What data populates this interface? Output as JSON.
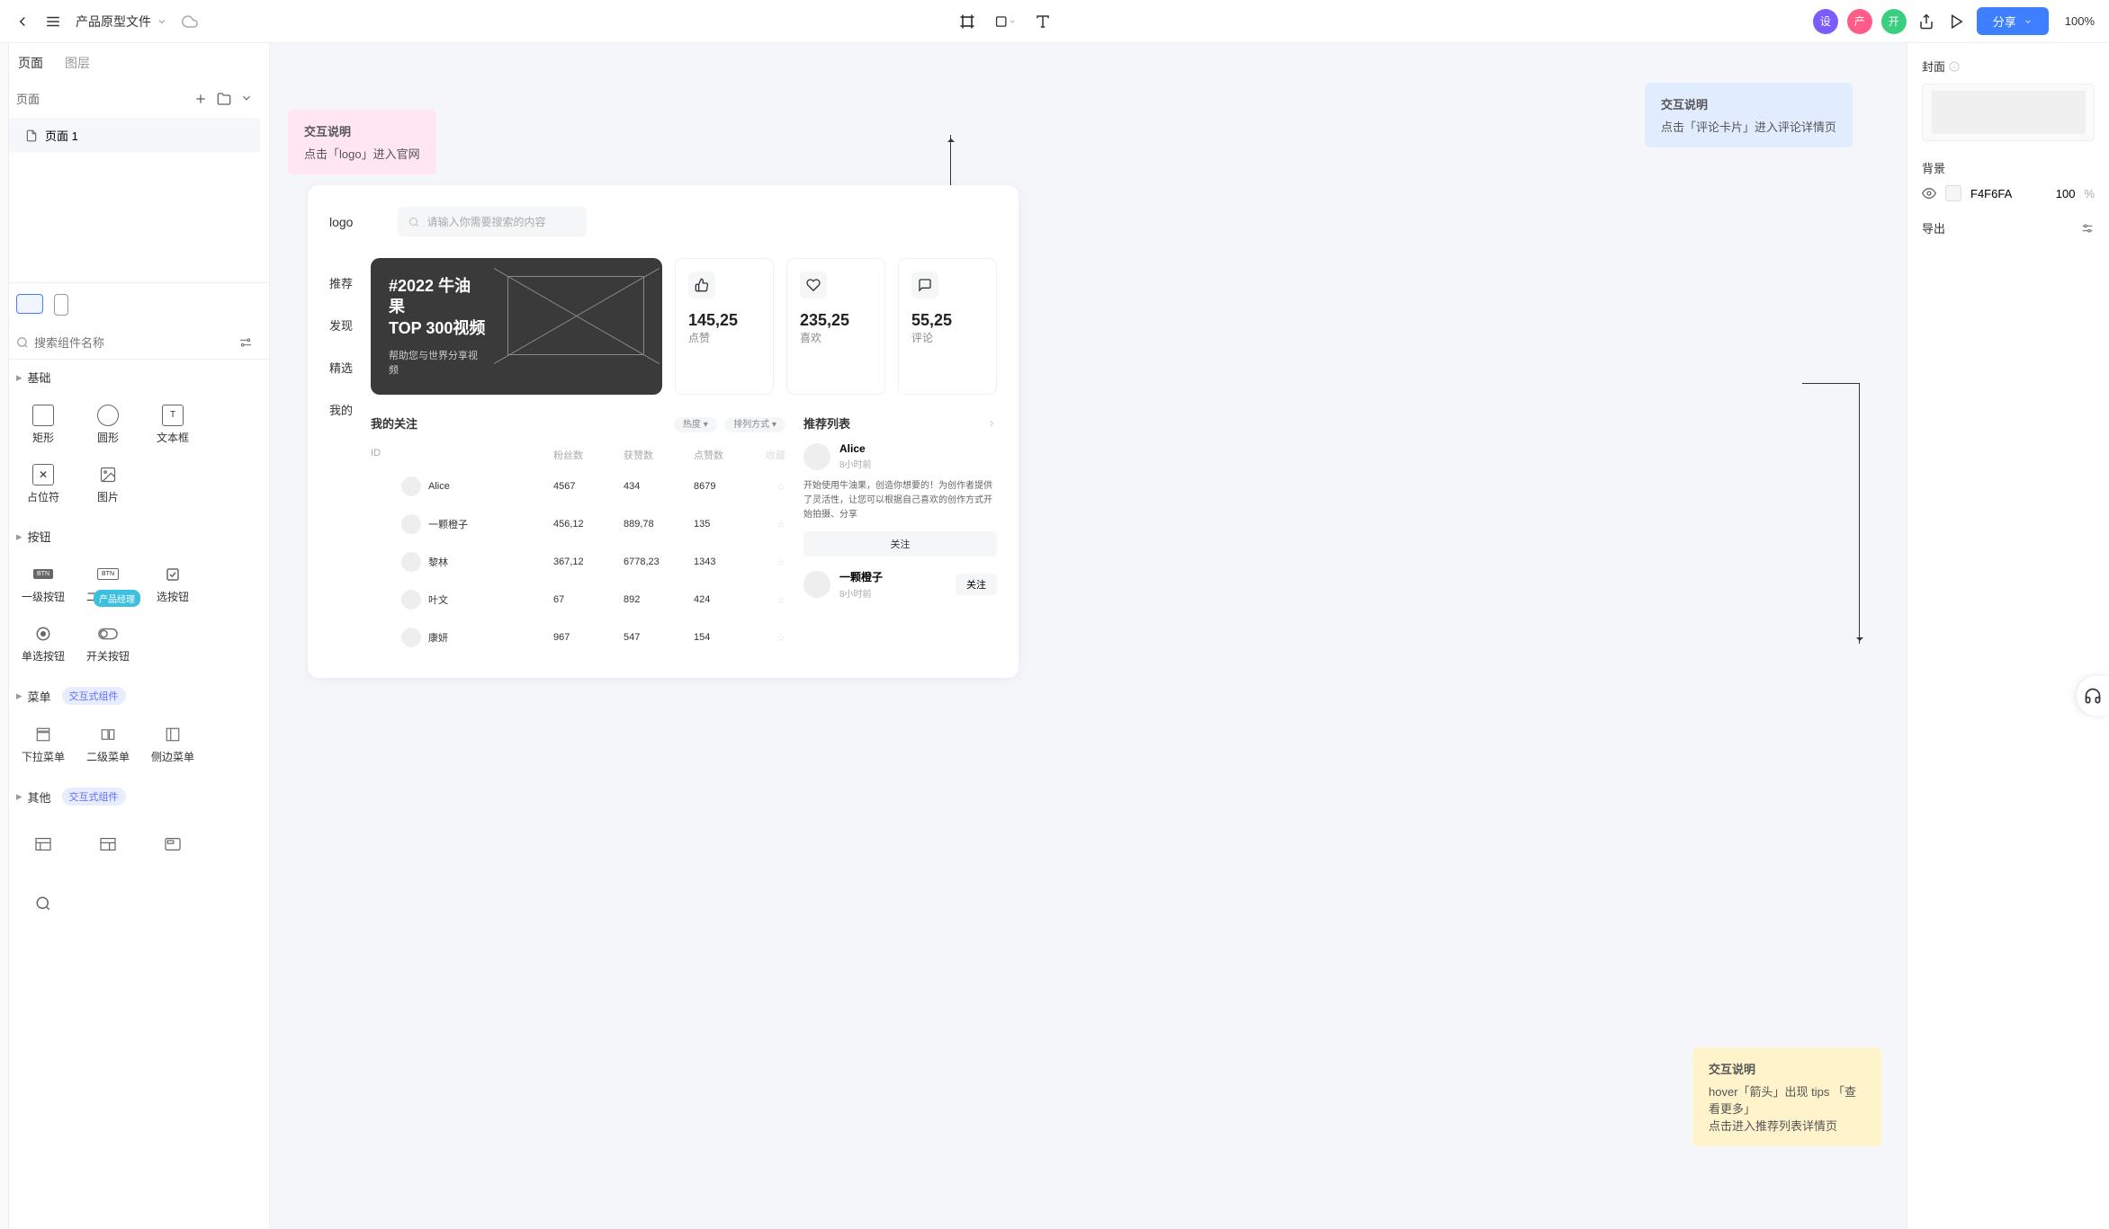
{
  "topbar": {
    "fileName": "产品原型文件",
    "shareLabel": "分享",
    "zoom": "100%",
    "roles": [
      "设",
      "产",
      "开"
    ]
  },
  "leftPanel": {
    "tabs": [
      "页面",
      "图层"
    ],
    "pagesLabel": "页面",
    "pages": [
      "页面 1"
    ],
    "searchPlaceholder": "搜索组件名称",
    "groups": {
      "basic": {
        "title": "基础",
        "items": [
          "矩形",
          "圆形",
          "文本框",
          "占位符",
          "图片"
        ]
      },
      "button": {
        "title": "按钮",
        "items": [
          "一级按钮",
          "二级按钮",
          "选按钮",
          "单选按钮",
          "开关按钮"
        ],
        "tooltip": "产品经理"
      },
      "menu": {
        "title": "菜单",
        "tag": "交互式组件",
        "items": [
          "下拉菜单",
          "二级菜单",
          "侧边菜单"
        ]
      },
      "other": {
        "title": "其他",
        "tag": "交互式组件"
      }
    }
  },
  "annotations": {
    "pink": {
      "title": "交互说明",
      "body": "点击「logo」进入官网"
    },
    "blue": {
      "title": "交互说明",
      "body": "点击「评论卡片」进入评论详情页"
    },
    "yellow": {
      "title": "交互说明",
      "body1": "hover「箭头」出现 tips 「查看更多」",
      "body2": "点击进入推荐列表详情页"
    }
  },
  "app": {
    "logo": "logo",
    "searchPlaceholder": "请输入你需要搜索的内容",
    "nav": [
      "推荐",
      "发现",
      "精选",
      "我的"
    ],
    "hero": {
      "title1": "#2022 牛油果",
      "title2": "TOP 300视频",
      "sub": "帮助您与世界分享视频"
    },
    "stats": [
      {
        "val": "145,25",
        "lbl": "点赞"
      },
      {
        "val": "235,25",
        "lbl": "喜欢"
      },
      {
        "val": "55,25",
        "lbl": "评论"
      }
    ],
    "followSection": {
      "title": "我的关注",
      "pills": [
        "热度",
        "排列方式"
      ],
      "headers": [
        "ID",
        "",
        "粉丝数",
        "获赞数",
        "点赞数",
        "收藏"
      ],
      "rows": [
        {
          "name": "Alice",
          "fans": "4567",
          "likes": "434",
          "upvotes": "8679"
        },
        {
          "name": "一颗橙子",
          "fans": "456,12",
          "likes": "889,78",
          "upvotes": "135"
        },
        {
          "name": "黎林",
          "fans": "367,12",
          "likes": "6778,23",
          "upvotes": "1343"
        },
        {
          "name": "叶文",
          "fans": "67",
          "likes": "892",
          "upvotes": "424"
        },
        {
          "name": "康妍",
          "fans": "967",
          "likes": "547",
          "upvotes": "154"
        }
      ]
    },
    "recoSection": {
      "title": "推荐列表",
      "card1": {
        "name": "Alice",
        "time": "8小时前",
        "desc": "开始使用牛油果，创造你想要的！为创作者提供了灵活性，让您可以根据自己喜欢的创作方式开始拍摄、分享",
        "followBtn": "关注"
      },
      "card2": {
        "name": "一颗橙子",
        "time": "8小时前",
        "followBtn": "关注"
      }
    }
  },
  "rightPanel": {
    "coverLabel": "封面",
    "bgLabel": "背景",
    "bgHex": "F4F6FA",
    "bgOpacity": "100",
    "bgPercent": "%",
    "exportLabel": "导出"
  }
}
